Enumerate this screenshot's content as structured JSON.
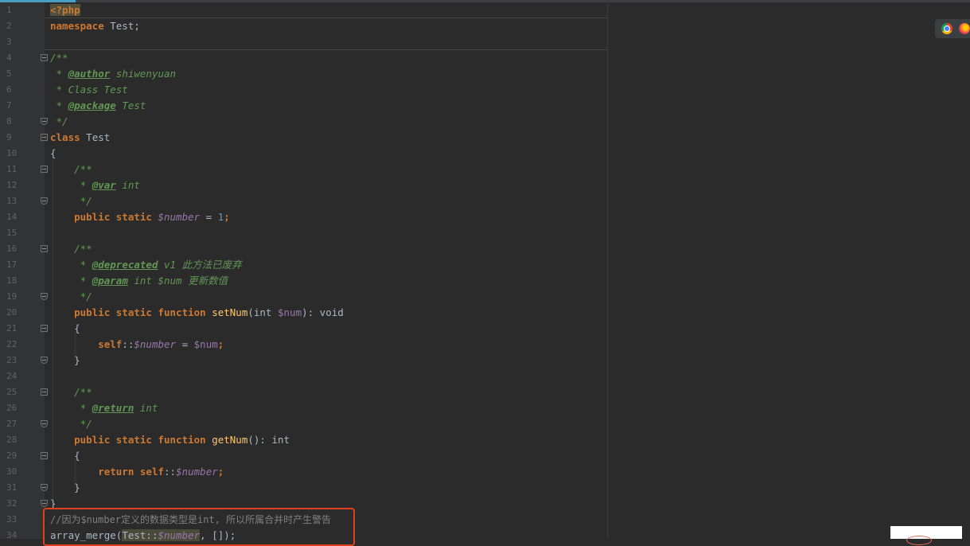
{
  "line_numbers": [
    "1",
    "2",
    "3",
    "4",
    "5",
    "6",
    "7",
    "8",
    "9",
    "10",
    "11",
    "12",
    "13",
    "14",
    "15",
    "16",
    "17",
    "18",
    "19",
    "20",
    "21",
    "22",
    "23",
    "24",
    "25",
    "26",
    "27",
    "28",
    "29",
    "30",
    "31",
    "32",
    "33",
    "34"
  ],
  "code": {
    "php_open": "<?php",
    "kw_namespace": "namespace",
    "ns_name": " Test;",
    "doc_open": "/**",
    "doc_star": " * ",
    "tag_author": "@author",
    "author_value": " shiwenyuan",
    "doc_class_line": " * Class Test",
    "tag_package": "@package",
    "package_value": " Test",
    "doc_close": " */",
    "kw_class": "class",
    "class_name": " Test",
    "brace_open": "{",
    "brace_close": "}",
    "doc_open_indent": "    /**",
    "doc_star_indent": "     * ",
    "doc_close_indent": "     */",
    "tag_var": "@var",
    "var_type": " int",
    "kw_public_static": "    public static ",
    "var_number": "$number",
    "assign_one_eq": " = ",
    "num_one": "1",
    "semi": ";",
    "tag_deprecated": "@deprecated",
    "deprecated_value": " v1 此方法已废弃",
    "tag_param": "@param",
    "param_value": " int $num 更新数值",
    "kw_public_static_function": "    public static function ",
    "fn_setnum": "setNum",
    "setnum_open": "(int ",
    "var_num": "$num",
    "setnum_close": "): void",
    "brace_open_indent": "    {",
    "brace_close_indent": "    }",
    "kw_self": "        self",
    "dcolon": "::",
    "tag_return": "@return",
    "return_type": " int",
    "fn_getnum": "getNum",
    "getnum_sig": "(): int",
    "kw_return": "        return ",
    "kw_self_plain": "self",
    "comment_line": "//因为$number定义的数据类型是int, 所以所属合并时产生警告",
    "array_merge": "array_merge(",
    "test_ref": "Test::",
    "array_merge_tail": ", []);"
  },
  "browser_icons": [
    "chrome-icon",
    "firefox-icon"
  ],
  "colors": {
    "background": "#2b2b2b",
    "gutter": "#313335",
    "keyword": "#cc7832",
    "doc_comment": "#629755",
    "variable": "#9876aa",
    "function": "#ffc66d",
    "number": "#6897bb",
    "highlight_box": "#e2401c"
  }
}
